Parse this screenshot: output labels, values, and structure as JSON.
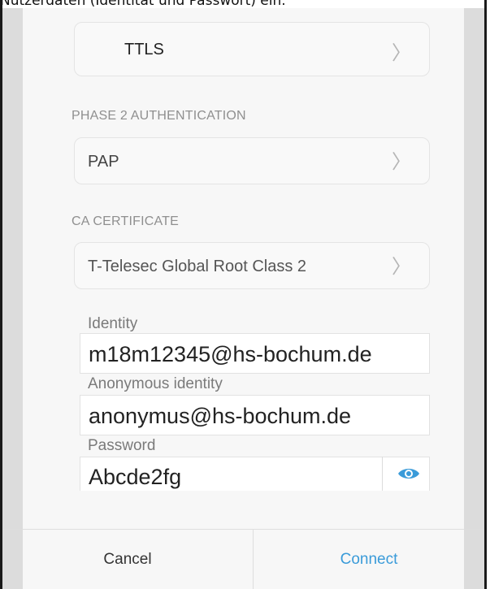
{
  "caption": "Nutzerdaten (Identität und Passwort) ein.",
  "eap_method": {
    "value": "TTLS"
  },
  "phase2": {
    "label": "PHASE 2 AUTHENTICATION",
    "value": "PAP"
  },
  "ca_certificate": {
    "label": "CA CERTIFICATE",
    "value": "T-Telesec Global Root Class 2"
  },
  "identity": {
    "label": "Identity",
    "value": "m18m12345@hs-bochum.de"
  },
  "anonymous_identity": {
    "label": "Anonymous identity",
    "value": "anonymus@hs-bochum.de"
  },
  "password": {
    "label": "Password",
    "value": "Abcde2fg"
  },
  "buttons": {
    "cancel": "Cancel",
    "connect": "Connect"
  },
  "colors": {
    "accent": "#3a9bd9",
    "chevron": "#b5b5b5",
    "label": "#8f8f8f"
  },
  "icons": {
    "chevron": "chevron-right-icon",
    "eye": "eye-icon"
  }
}
